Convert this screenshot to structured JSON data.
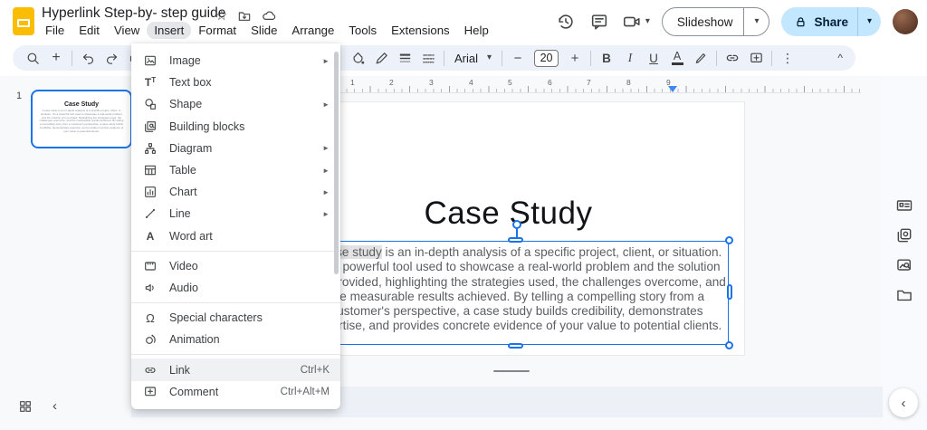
{
  "colors": {
    "accent_blue": "#1a73e8",
    "brand_yellow": "#fbbc04",
    "share_bg": "#c2e7ff",
    "toolbar_bg": "#edf2fa",
    "selection_gray": "#e2e2e2"
  },
  "icons": {
    "dropdown": "▾",
    "submenu_arrow": "►",
    "chevron_left": "‹",
    "collapse_toolbar": "^",
    "more_vertical": "⋮",
    "star": "☆",
    "omega": "Ω",
    "minus": "−",
    "plus": "+",
    "wordart_a": "A",
    "textbox_t": "T",
    "textbox_t_small": "T"
  },
  "titlebar": {
    "doc_title": "Hyperlink Step-by- step guide",
    "menus": [
      "File",
      "Edit",
      "View",
      "Insert",
      "Format",
      "Slide",
      "Arrange",
      "Tools",
      "Extensions",
      "Help"
    ],
    "slideshow_label": "Slideshow",
    "share_label": "Share"
  },
  "toolbar": {
    "font_name": "Arial",
    "font_size": "20",
    "bold": "B",
    "italic": "I",
    "underline": "U",
    "text_color": "A"
  },
  "insert_menu": {
    "items": [
      {
        "label": "Image",
        "submenu": "►"
      },
      {
        "label": "Text box"
      },
      {
        "label": "Shape",
        "submenu": "►"
      },
      {
        "label": "Building blocks"
      },
      {
        "label": "Diagram",
        "submenu": "►"
      },
      {
        "label": "Table",
        "submenu": "►"
      },
      {
        "label": "Chart",
        "submenu": "►"
      },
      {
        "label": "Line",
        "submenu": "►"
      },
      {
        "label": "Word art"
      },
      {
        "label": "Video"
      },
      {
        "label": "Audio"
      },
      {
        "label": "Special characters"
      },
      {
        "label": "Animation"
      },
      {
        "label": "Link",
        "shortcut": "Ctrl+K"
      },
      {
        "label": "Comment",
        "shortcut": "Ctrl+Alt+M"
      }
    ]
  },
  "filmstrip": {
    "slide_number": "1",
    "thumb_title": "Case Study",
    "thumb_body": "A case study is an in-depth analysis of a specific project, client, or situation. It's a powerful tool used to showcase a real-world problem and the solution you provided, highlighting the strategies used, the challenges overcome, and the measurable results achieved. By telling a compelling story from a customer's perspective, a case study builds credibility, demonstrates expertise, and provides concrete evidence of your value to potential clients."
  },
  "ruler": {
    "numbers": [
      "1",
      "2",
      "3",
      "4",
      "5",
      "6",
      "7",
      "8",
      "9"
    ]
  },
  "slide": {
    "title": "Case Study",
    "body_pre": "A ",
    "body_selected": "case study",
    "body_post": " is an in-depth analysis of a specific project, client, or situation. It's a powerful tool used to showcase a real-world problem and the solution you provided, highlighting the strategies used, the challenges overcome, and the measurable results achieved. By telling a compelling story from a customer's perspective, a case study builds credibility, demonstrates expertise, and provides concrete evidence of your value to potential clients."
  }
}
